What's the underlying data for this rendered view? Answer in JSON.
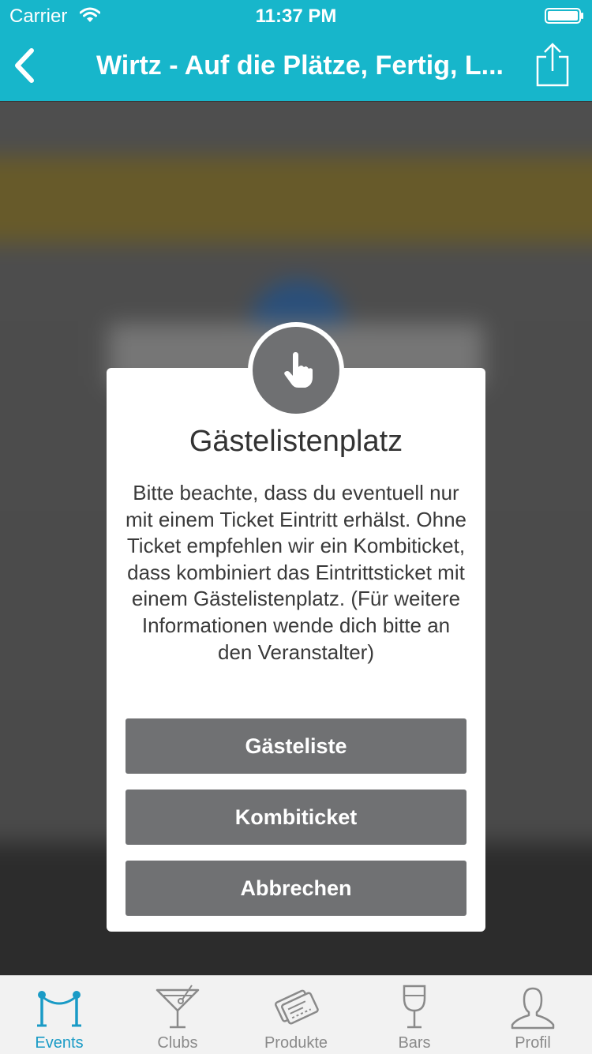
{
  "status_bar": {
    "carrier": "Carrier",
    "time": "11:37 PM"
  },
  "nav": {
    "title": "Wirtz - Auf die Plätze, Fertig, L..."
  },
  "dialog": {
    "title": "Gästelistenplatz",
    "message": "Bitte beachte, dass du eventuell nur mit einem Ticket Eintritt erhälst. Ohne Ticket empfehlen wir ein Kombiticket, dass kombiniert das Eintrittsticket mit einem Gästelistenplatz. (Für weitere Informationen wende dich bitte an den Veranstalter)",
    "buttons": [
      {
        "label": "Gästeliste"
      },
      {
        "label": "Kombiticket"
      },
      {
        "label": "Abbrechen"
      }
    ]
  },
  "tab_bar": {
    "tabs": [
      {
        "label": "Events",
        "icon": "rope-barrier-icon",
        "active": true
      },
      {
        "label": "Clubs",
        "icon": "cocktail-glass-icon",
        "active": false
      },
      {
        "label": "Produkte",
        "icon": "tickets-icon",
        "active": false
      },
      {
        "label": "Bars",
        "icon": "wine-glass-icon",
        "active": false
      },
      {
        "label": "Profil",
        "icon": "person-icon",
        "active": false
      }
    ]
  },
  "colors": {
    "header": "#17b6cb",
    "active_tab": "#1a9bc6",
    "inactive_tab": "#8a8a8a",
    "dialog_button": "#707173"
  }
}
